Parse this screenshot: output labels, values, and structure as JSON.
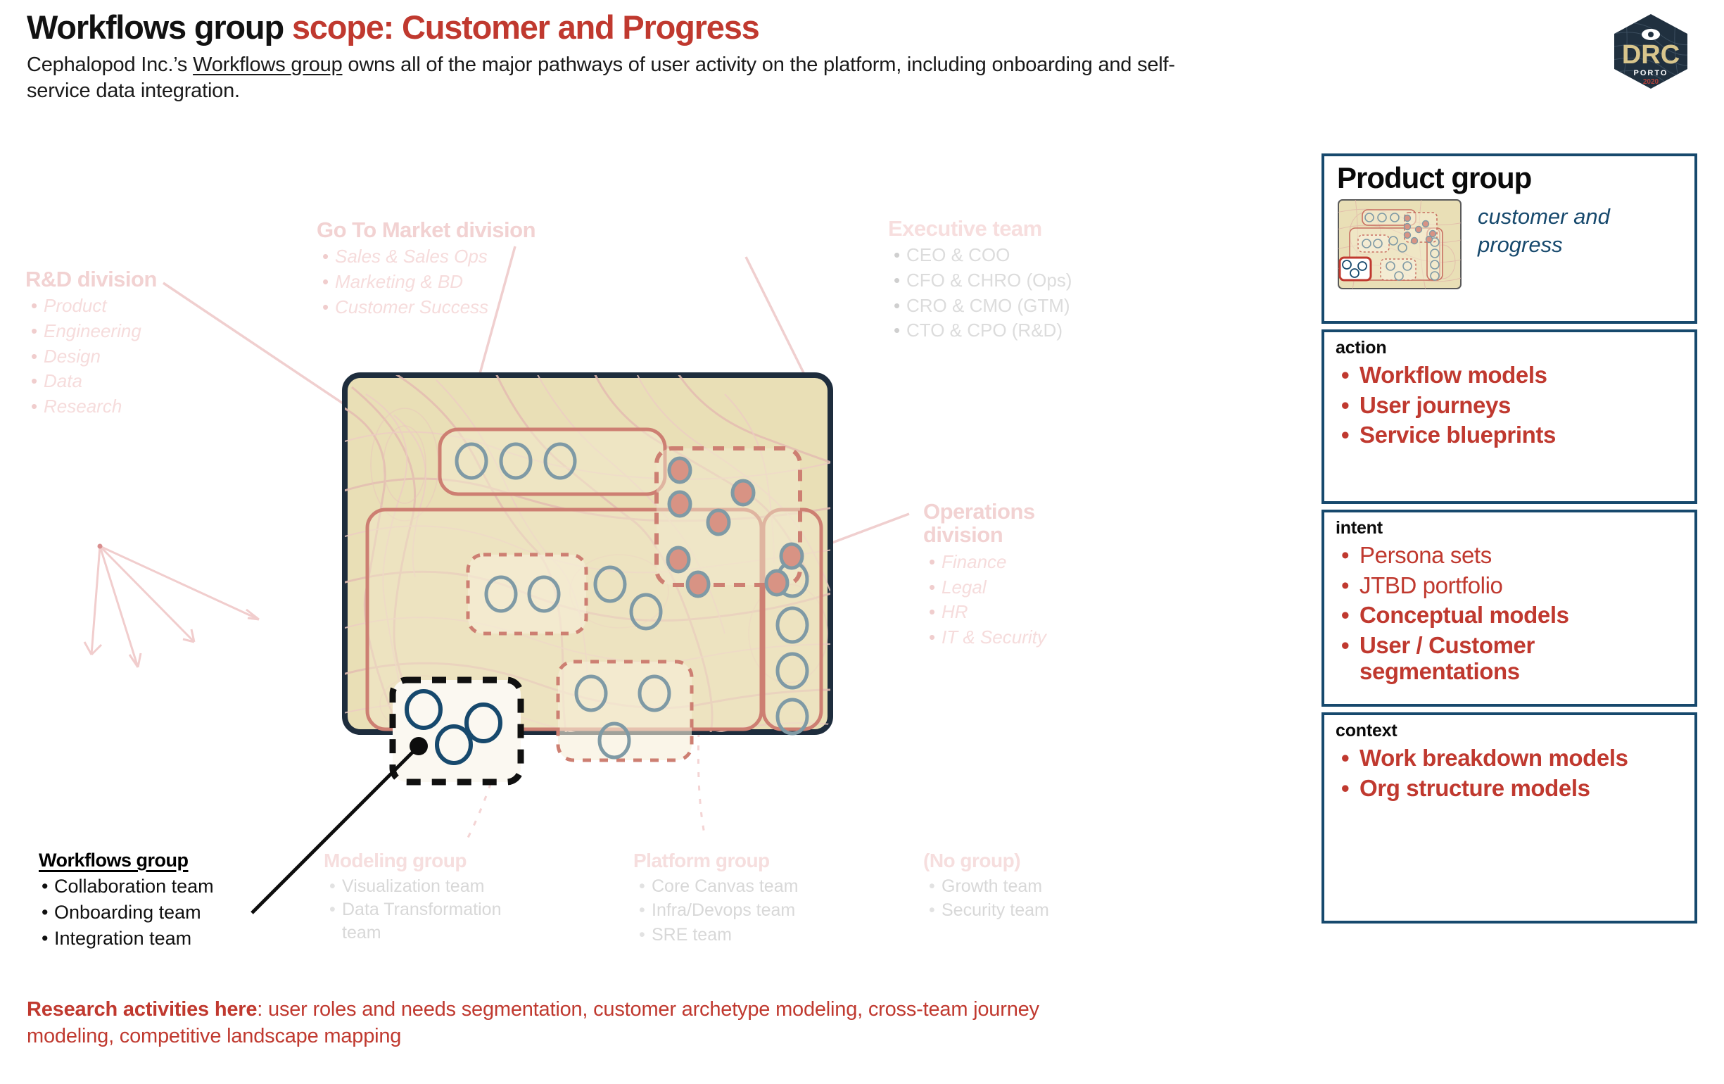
{
  "header": {
    "title_black": "Workflows group ",
    "title_red": "scope: Customer and Progress",
    "subtitle_a": "Cephalopod Inc.’s ",
    "subtitle_underlined": "Workflows group",
    "subtitle_b": " owns all of the major pathways of user activity on the platform, including onboarding and self-service data integration."
  },
  "logo": {
    "word": "DRC",
    "city": "PORTO",
    "year": "2020"
  },
  "diagram": {
    "go_to_market": {
      "title": "Go To Market division",
      "items": [
        "Sales & Sales Ops",
        "Marketing & BD",
        "Customer Success"
      ]
    },
    "executive": {
      "title": "Executive team",
      "items": [
        "CEO & COO",
        "CFO & CHRO (Ops)",
        "CRO & CMO (GTM)",
        "CTO & CPO (R&D)"
      ]
    },
    "rnd": {
      "title": "R&D division",
      "items": [
        "Product",
        "Engineering",
        "Design",
        "Data",
        "Research"
      ]
    },
    "operations": {
      "title": "Operations\ndivision",
      "title_line1": "Operations",
      "title_line2": "division",
      "items": [
        "Finance",
        "Legal",
        "HR",
        "IT & Security"
      ]
    },
    "workflows": {
      "title": "Workflows group",
      "items": [
        "Collaboration team",
        "Onboarding team",
        "Integration team"
      ]
    },
    "modeling": {
      "title": "Modeling group",
      "items": [
        "Visualization team",
        "Data Transformation team"
      ]
    },
    "platform": {
      "title": "Platform group",
      "items": [
        "Core Canvas team",
        "Infra/Devops team",
        "SRE team"
      ]
    },
    "nogroup": {
      "title": "(No group)",
      "items": [
        "Growth team",
        "Security team"
      ]
    }
  },
  "research": {
    "lead": "Research activities here",
    "body": ": user roles and needs segmentation, customer archetype modeling, cross-team journey modeling, competitive landscape mapping"
  },
  "panel": {
    "heading": "Product group",
    "subheading": "customer and progress",
    "sections": [
      {
        "caption": "action",
        "items": [
          {
            "label": "Workflow models",
            "weight": "bold"
          },
          {
            "label": "User journeys",
            "weight": "bold"
          },
          {
            "label": "Service blueprints",
            "weight": "bold"
          }
        ]
      },
      {
        "caption": "intent",
        "items": [
          {
            "label": "Persona sets",
            "weight": "light"
          },
          {
            "label": "JTBD portfolio",
            "weight": "light"
          },
          {
            "label": "Conceptual models",
            "weight": "bold"
          },
          {
            "label": "User / Customer segmentations",
            "weight": "bold"
          }
        ]
      },
      {
        "caption": "context",
        "items": [
          {
            "label": "Work breakdown models",
            "weight": "bold"
          },
          {
            "label": "Org structure models",
            "weight": "bold"
          }
        ]
      }
    ]
  },
  "colors": {
    "accent_red": "#c0392f",
    "panel_border": "#17496d",
    "map_fill": "#e9dfb6",
    "map_stroke": "#1e2d3d",
    "region_pink": "#cd7f72",
    "node_ring": "#7f9aa5",
    "node_ring_active": "#17496d",
    "node_fill_exec": "#d89384",
    "label_pink": "#f4d6d6",
    "label_grey": "#d8d8d8"
  }
}
